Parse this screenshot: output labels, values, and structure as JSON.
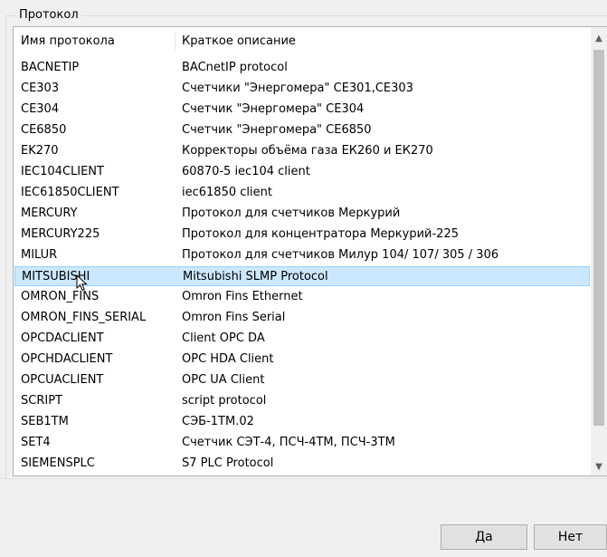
{
  "group": {
    "title": "Протокол"
  },
  "table": {
    "columns": [
      "Имя протокола",
      "Краткое описание"
    ],
    "rows": [
      {
        "name": "BACNETIP",
        "desc": "BACnetIP protocol"
      },
      {
        "name": "CE303",
        "desc": "Счетчики \"Энергомера\" CE301,CE303"
      },
      {
        "name": "CE304",
        "desc": "Счетчик \"Энергомера\" CE304"
      },
      {
        "name": "CE6850",
        "desc": "Счетчик \"Энергомера\" CE6850"
      },
      {
        "name": "EK270",
        "desc": "Корректоры объёма газа ЕК260 и ЕК270"
      },
      {
        "name": "IEC104CLIENT",
        "desc": "60870-5 iec104 client"
      },
      {
        "name": "IEC61850CLIENT",
        "desc": "iec61850 client"
      },
      {
        "name": "MERCURY",
        "desc": "Протокол для счетчиков Меркурий"
      },
      {
        "name": "MERCURY225",
        "desc": "Протокол для концентратора Меркурий-225"
      },
      {
        "name": "MILUR",
        "desc": "Протокол для счетчиков Милур 104/ 107/ 305 / 306"
      },
      {
        "name": "MITSUBISHI",
        "desc": "Mitsubishi SLMP Protocol"
      },
      {
        "name": "OMRON_FINS",
        "desc": "Omron Fins Ethernet"
      },
      {
        "name": "OMRON_FINS_SERIAL",
        "desc": "Omron Fins Serial"
      },
      {
        "name": "OPCDACLIENT",
        "desc": "Client OPC DA"
      },
      {
        "name": "OPCHDACLIENT",
        "desc": "OPC HDA Client"
      },
      {
        "name": "OPCUACLIENT",
        "desc": "OPC UA Client"
      },
      {
        "name": "SCRIPT",
        "desc": "script protocol"
      },
      {
        "name": "SEB1TM",
        "desc": "СЭБ-1ТМ.02"
      },
      {
        "name": "SET4",
        "desc": "Счетчик СЭТ-4, ПСЧ-4ТМ, ПСЧ-3ТМ"
      },
      {
        "name": "SIEMENSPLC",
        "desc": "S7 PLC Protocol"
      }
    ],
    "selected_index": 10
  },
  "scrollbar": {
    "up_icon": "chevron-up-icon",
    "down_icon": "chevron-down-icon"
  },
  "buttons": {
    "yes": "Да",
    "no": "Нет"
  }
}
